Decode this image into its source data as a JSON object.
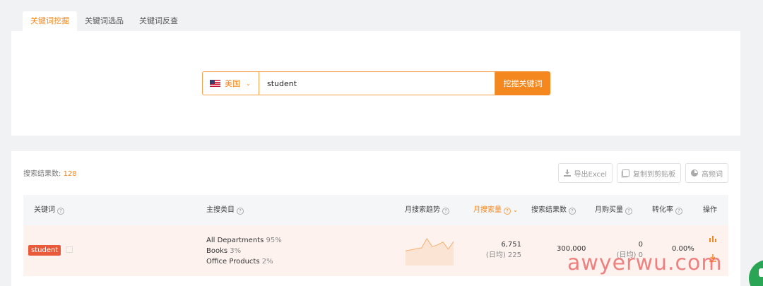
{
  "tabs": [
    "关键词挖掘",
    "关键词选品",
    "关键词反查"
  ],
  "search": {
    "country": "美国",
    "query": "student",
    "button": "挖掘关键词"
  },
  "results": {
    "count_label": "搜索结果数:",
    "count": "128",
    "actions": [
      "导出Excel",
      "复制到剪贴板",
      "高频词"
    ]
  },
  "table": {
    "columns": [
      "关键词",
      "主搜类目",
      "月搜索趋势",
      "月搜索量",
      "搜索结果数",
      "月购买量",
      "转化率",
      "操作"
    ],
    "help_mark": "?",
    "row": {
      "keyword": "student",
      "categories": [
        {
          "name": "All Departments",
          "pct": "95%"
        },
        {
          "name": "Books",
          "pct": "3%"
        },
        {
          "name": "Office Products",
          "pct": "2%"
        }
      ],
      "trend": [
        52,
        50,
        47,
        45,
        23,
        42,
        38,
        31,
        48,
        30
      ],
      "monthly_volume": "6,751",
      "daily_volume": "(日均) 225",
      "result_count": "300,000",
      "monthly_purchase": "0",
      "daily_purchase": "(日均) 0",
      "conversion": "0.00%"
    }
  },
  "watermark": "awyerwu.com",
  "colors": {
    "accent": "#f5871f",
    "tag": "#ea5a3a"
  },
  "icons": [
    "us-flag-icon",
    "chevron-down-icon",
    "download-icon",
    "copy-icon",
    "pie-chart-icon",
    "help-icon",
    "external-link-icon",
    "bar-chart-icon",
    "chat-icon"
  ]
}
